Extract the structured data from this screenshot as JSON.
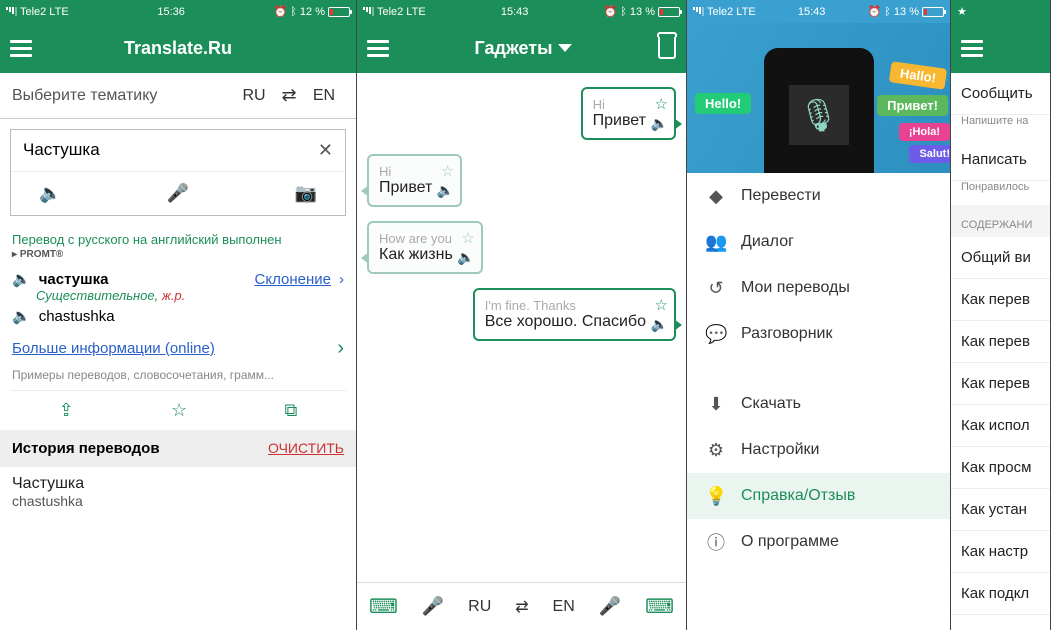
{
  "status": {
    "carrier": "Tele2",
    "net": "LTE",
    "time1": "15:36",
    "time2": "15:43",
    "time3": "15:43",
    "batt1": "12 %",
    "batt2": "13 %",
    "batt3": "13 %"
  },
  "p1": {
    "title": "Translate.Ru",
    "topic": "Выберите тематику",
    "src": "RU",
    "dst": "EN",
    "input": "Частушка",
    "promt_line": "Перевод с русского на английский выполнен",
    "promt_logo": "PROMT",
    "headword": "частушка",
    "declension": "Склонение",
    "pos": "Существительное, ",
    "gender": "ж.р.",
    "translit": "chastushka",
    "more": "Больше информации (online)",
    "more_sub": "Примеры переводов, словосочетания, грамм...",
    "history_title": "История переводов",
    "clear": "ОЧИСТИТЬ",
    "hist_q": "Частушка",
    "hist_a": "chastushka"
  },
  "p2": {
    "title": "Гаджеты",
    "msgs": [
      {
        "side": "right",
        "src": "Hi",
        "dst": "Привет"
      },
      {
        "side": "left",
        "src": "Hi",
        "dst": "Привет"
      },
      {
        "side": "left",
        "src": "How are you",
        "dst": "Как жизнь"
      },
      {
        "side": "right",
        "src": "I'm fine. Thanks",
        "dst": "Все хорошо. Спасибо"
      }
    ],
    "src": "RU",
    "dst": "EN"
  },
  "p3": {
    "hero": {
      "hello": "Hello!",
      "hallo": "Hallo!",
      "privet": "Привет!",
      "hola": "¡Hola!",
      "salut": "Salut!"
    },
    "menu1": [
      "Перевести",
      "Диалог",
      "Мои переводы",
      "Разговорник"
    ],
    "menu2": [
      "Скачать",
      "Настройки",
      "Справка/Отзыв",
      "О программе"
    ]
  },
  "p4": {
    "r1": "Сообщить",
    "r1s": "Напишите на",
    "r2": "Написать",
    "r2s": "Понравилось",
    "sec": "СОДЕРЖАНИ",
    "rows": [
      "Общий ви",
      "Как перев",
      "Как перев",
      "Как перев",
      "Как испол",
      "Как просм",
      "Как устан",
      "Как настр",
      "Как подкл"
    ]
  }
}
